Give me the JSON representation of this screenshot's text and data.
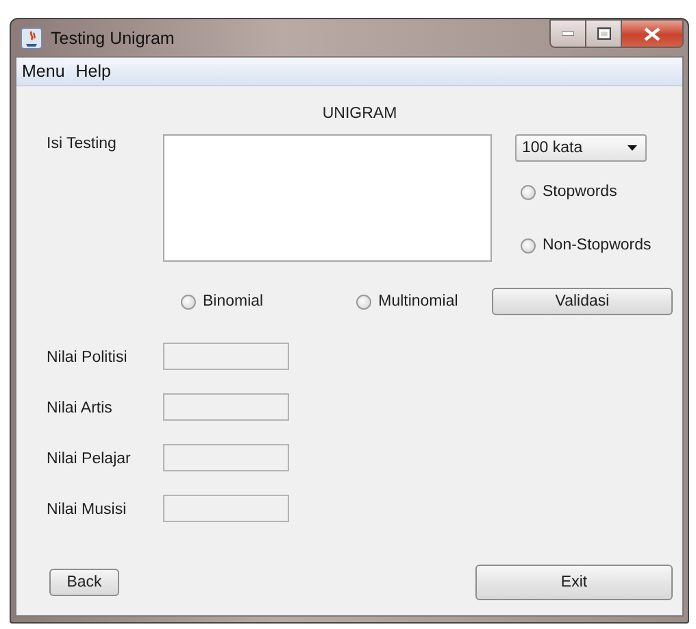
{
  "window": {
    "title": "Testing Unigram"
  },
  "menu_bar": [
    {
      "label": "Menu"
    },
    {
      "label": "Help"
    }
  ],
  "heading": "UNIGRAM",
  "input_label": "Isi Testing",
  "word_count": {
    "value": "100 kata"
  },
  "stopword_options": [
    {
      "label": "Stopwords",
      "selected": false
    },
    {
      "label": "Non-Stopwords",
      "selected": false
    }
  ],
  "model_options": [
    {
      "label": "Binomial",
      "selected": false
    },
    {
      "label": "Multinomial",
      "selected": false
    }
  ],
  "validate_button": "Validasi",
  "scores": [
    {
      "label": "Nilai Politisi"
    },
    {
      "label": "Nilai Artis"
    },
    {
      "label": "Nilai Pelajar"
    },
    {
      "label": "Nilai Musisi"
    }
  ],
  "buttons": {
    "back": "Back",
    "exit": "Exit"
  }
}
